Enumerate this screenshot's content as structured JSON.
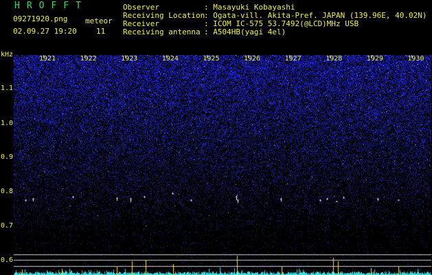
{
  "header": {
    "logo": "HROFFT",
    "filename": "09271920.png",
    "meteor_label": "meteor",
    "datetime": "02.09.27 19:20",
    "meteor_count": "11",
    "info": [
      {
        "key": "Observer",
        "value": ": Masayuki Kobayashi"
      },
      {
        "key": "Receiving Location",
        "value": ": Ogata-vill. Akita-Pref. JAPAN (139.96E, 40.02N)"
      },
      {
        "key": "Receiver",
        "value": ": ICOM IC-575 53.7492(@LCD)MHz USB"
      },
      {
        "key": "Receiving antenna",
        "value": ": A504HB(yagi 4el)"
      }
    ]
  },
  "spectrogram": {
    "y_unit": "kHz",
    "y_ticks": [
      "1.1",
      "1.0",
      "0.9",
      "0.8",
      "0.7",
      "0.6"
    ],
    "x_ticks": [
      "1921",
      "1922",
      "1923",
      "1924",
      "1925",
      "1926",
      "1927",
      "1928",
      "1929",
      "1930"
    ],
    "colors": {
      "noise": "#1a1f8c",
      "meteor": "#ffffff",
      "spectrum": "#39e0e0",
      "peak": "#ffe23a",
      "text": "#f2f24a"
    }
  }
}
